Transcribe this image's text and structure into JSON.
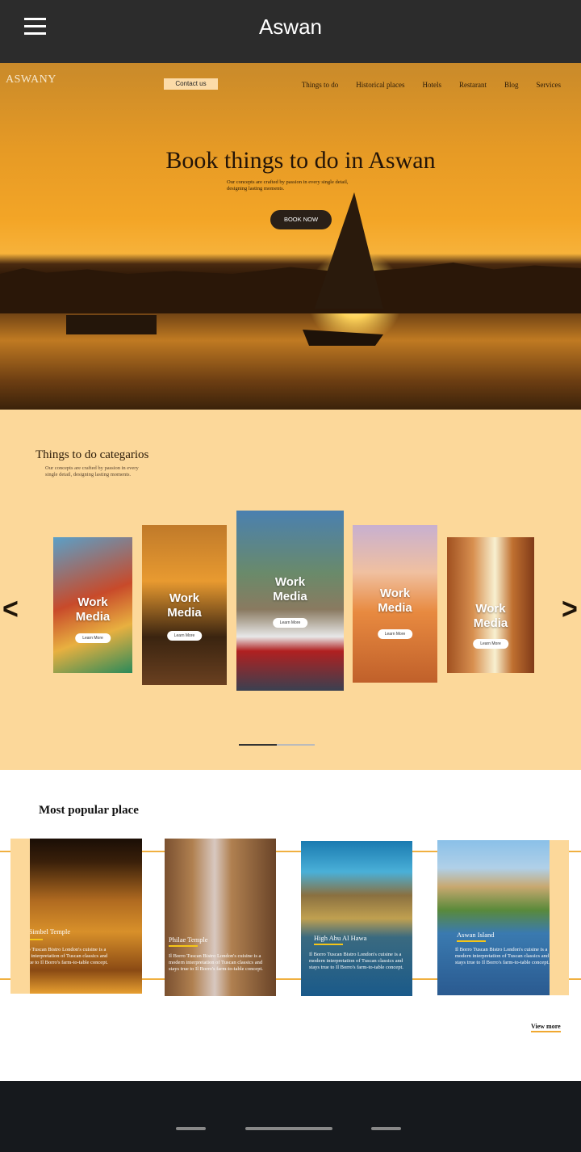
{
  "app": {
    "title": "Aswan",
    "menu_icon": "hamburger-menu-icon"
  },
  "hero": {
    "logo": "ASWANY",
    "contact": "Contact us",
    "nav": [
      "Things to do",
      "Historical places",
      "Hotels",
      "Restarant",
      "Blog",
      "Services"
    ],
    "title": "Book things to do in Aswan",
    "subtitle_line1": "Our concepts are crafted by passion in every single detail,",
    "subtitle_line2": "designing lasting moments.",
    "cta": "BOOK NOW"
  },
  "categories": {
    "title": "Things to do categarios",
    "subtitle_line1": "Our concepts are crafted by passion in every",
    "subtitle_line2": "single detail, designing lasting moments.",
    "prev": "<",
    "next": ">",
    "cards": [
      {
        "title1": "Work",
        "title2": "Media",
        "button": "Learn More"
      },
      {
        "title1": "Work",
        "title2": "Media",
        "button": "Learn More"
      },
      {
        "title1": "Work",
        "title2": "Media",
        "button": "Learn More"
      },
      {
        "title1": "Work",
        "title2": "Media",
        "button": "Learn More"
      },
      {
        "title1": "Work",
        "title2": "Media",
        "button": "Learn More"
      }
    ],
    "pagination_progress": 0.5
  },
  "popular": {
    "title": "Most popular place",
    "places": [
      {
        "name": "Abu Simbel Temple",
        "desc": "Il Borro Tuscan Bistro London's cuisine is a modern interpretation of Tuscan classics and stays true to Il Borro's farm-to-table concept."
      },
      {
        "name": "Philae Temple",
        "desc": "Il Borro Tuscan Bistro London's cuisine is a modern interpretation of Tuscan classics and stays true to Il Borro's farm-to-table concept."
      },
      {
        "name": "High Abu Al Hawa",
        "desc": "Il Borro Tuscan Bistro London's cuisine is a modern interpretation of Tuscan classics and stays true to Il Borro's farm-to-table concept."
      },
      {
        "name": "Aswan Island",
        "desc": "Il Borro Tuscan Bistro London's cuisine is a modern interpretation of Tuscan classics and stays true to Il Borro's farm-to-table concept."
      }
    ],
    "view_more": "View more"
  },
  "colors": {
    "topbar": "#2c2c2c",
    "peach": "#fcd89a",
    "accent": "#f0b040",
    "navbar": "#16191d"
  }
}
